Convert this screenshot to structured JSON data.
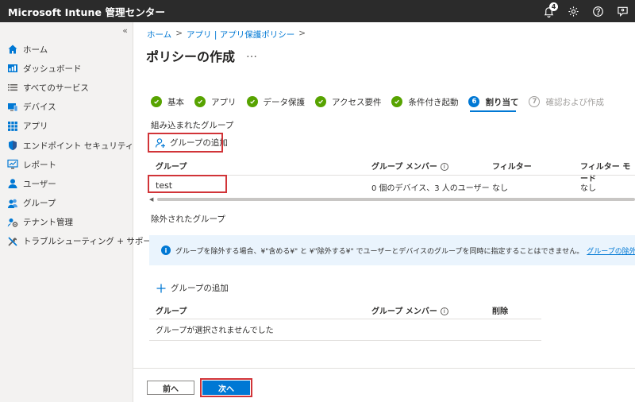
{
  "app": {
    "title": "Microsoft Intune 管理センター",
    "notification_count": "4"
  },
  "topbar": {
    "icons": [
      "bell-icon",
      "gear-icon",
      "help-icon",
      "feedback-icon"
    ]
  },
  "sidebar": {
    "collapse_glyph": "«",
    "items": [
      {
        "label": "ホーム",
        "icon": "home-icon"
      },
      {
        "label": "ダッシュボード",
        "icon": "dashboard-icon"
      },
      {
        "label": "すべてのサービス",
        "icon": "list-icon"
      },
      {
        "label": "デバイス",
        "icon": "devices-icon"
      },
      {
        "label": "アプリ",
        "icon": "apps-icon"
      },
      {
        "label": "エンドポイント セキュリティ",
        "icon": "shield-icon"
      },
      {
        "label": "レポート",
        "icon": "reports-icon"
      },
      {
        "label": "ユーザー",
        "icon": "user-icon"
      },
      {
        "label": "グループ",
        "icon": "group-icon"
      },
      {
        "label": "テナント管理",
        "icon": "tenant-icon"
      },
      {
        "label": "トラブルシューティング + サポート",
        "icon": "tools-icon"
      }
    ]
  },
  "breadcrumb": {
    "items": [
      "ホーム",
      "アプリ | アプリ保護ポリシー"
    ],
    "sep": ">"
  },
  "page": {
    "title": "ポリシーの作成",
    "more": "…"
  },
  "steps": [
    {
      "label": "基本",
      "state": "done",
      "num": ""
    },
    {
      "label": "アプリ",
      "state": "done",
      "num": ""
    },
    {
      "label": "データ保護",
      "state": "done",
      "num": ""
    },
    {
      "label": "アクセス要件",
      "state": "done",
      "num": ""
    },
    {
      "label": "条件付き起動",
      "state": "done",
      "num": ""
    },
    {
      "label": "割り当て",
      "state": "current",
      "num": "6"
    },
    {
      "label": "確認および作成",
      "state": "pending",
      "num": "7"
    }
  ],
  "included": {
    "section_label": "組み込まれたグループ",
    "add_label": "グループの追加",
    "columns": {
      "group": "グループ",
      "members": "グループ メンバー",
      "filter": "フィルター",
      "filter_mode": "フィルター モード"
    },
    "row": {
      "group": "test",
      "members": "0 個のデバイス、3 人のユーザー",
      "filter": "なし",
      "filter_mode": "なし"
    }
  },
  "excluded": {
    "section_label": "除外されたグループ",
    "info_text": "グループを除外する場合、¥\"含める¥\" と ¥\"除外する¥\" でユーザーとデバイスのグループを同時に指定することはできません。",
    "info_link": "グループの除外の詳細については、ここ",
    "add_label": "グループの追加",
    "columns": {
      "group": "グループ",
      "members": "グループ メンバー",
      "delete": "削除"
    },
    "empty_text": "グループが選択されませんでした"
  },
  "footer": {
    "back_label": "前へ",
    "next_label": "次へ"
  },
  "colors": {
    "accent": "#0078d4",
    "success": "#57a300",
    "highlight": "#d13438",
    "topbar": "#2b2b2b"
  }
}
